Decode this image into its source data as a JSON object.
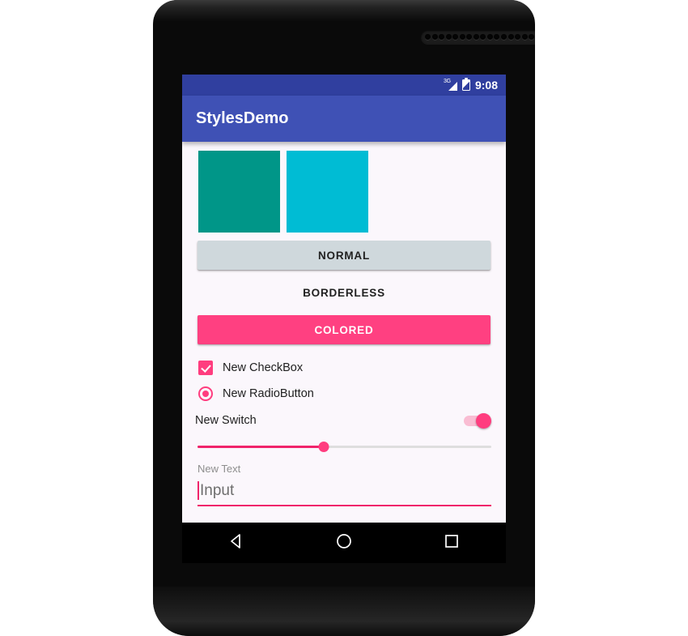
{
  "device": {
    "name": "android-phone-mockup",
    "speaker_hole_count": 21
  },
  "status_bar": {
    "signal_label": "3G",
    "signal_icon": "signal-bars-icon",
    "battery_icon": "battery-charging-icon",
    "clock": "9:08",
    "background": "#303F9F"
  },
  "app_bar": {
    "title": "StylesDemo",
    "background": "#3F51B5",
    "text_color": "#FFFFFF"
  },
  "content": {
    "background": "#FBF7FC",
    "swatches": [
      {
        "name": "primary-swatch",
        "color": "#009688"
      },
      {
        "name": "accent-swatch",
        "color": "#00BCD4"
      }
    ],
    "buttons": [
      {
        "name": "normal-button",
        "label": "NORMAL",
        "style": "raised",
        "background": "#CFD8DC",
        "text_color": "#212121"
      },
      {
        "name": "borderless-button",
        "label": "BORDERLESS",
        "style": "borderless",
        "background": "transparent",
        "text_color": "#212121"
      },
      {
        "name": "colored-button",
        "label": "COLORED",
        "style": "raised-colored",
        "background": "#FF4081",
        "text_color": "#FFFFFF"
      }
    ],
    "checkbox": {
      "label": "New CheckBox",
      "checked": true,
      "color": "#FF3D7F"
    },
    "radio": {
      "label": "New RadioButton",
      "selected": true,
      "color": "#FF3D7F"
    },
    "switch": {
      "label": "New Switch",
      "on": true,
      "thumb_color": "#FF3D7F",
      "track_color": "#F9BDD3"
    },
    "slider": {
      "name": "seek-bar",
      "value_percent": 43,
      "fill_color": "#F0246B",
      "track_color": "#DEDEDE",
      "thumb_color": "#FF3D7F"
    },
    "text_field": {
      "label": "New Text",
      "value": "Input",
      "placeholder": "Input",
      "underline_color": "#F0246B",
      "caret_color": "#F0246B",
      "text_color": "#6E6E6E"
    }
  },
  "nav_bar": {
    "background": "#000000",
    "buttons": [
      {
        "name": "nav-back-button",
        "icon": "triangle-back-icon"
      },
      {
        "name": "nav-home-button",
        "icon": "circle-home-icon"
      },
      {
        "name": "nav-recents-button",
        "icon": "square-recents-icon"
      }
    ]
  }
}
